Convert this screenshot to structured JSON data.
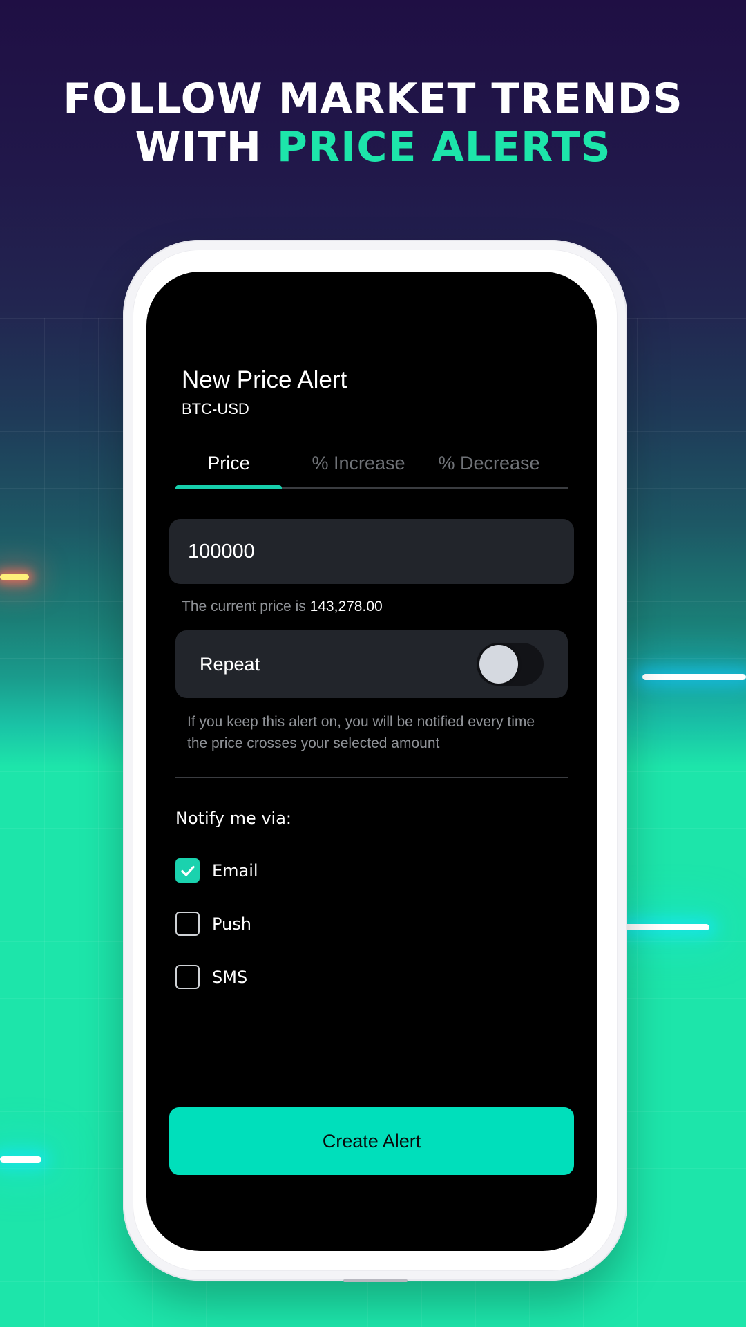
{
  "promo": {
    "headline_line1": "FOLLOW MARKET TRENDS",
    "headline_line2_prefix": "WITH ",
    "headline_line2_accent": "PRICE ALERTS"
  },
  "colors": {
    "accent": "#1de5aa",
    "button": "#00dfbb",
    "tab_indicator": "#17cfac",
    "checkbox_checked": "#1ad2ae",
    "background_top": "#1f0f44",
    "screen_bg": "#000000",
    "card_bg": "#22252b"
  },
  "screen": {
    "title": "New Price Alert",
    "pair": "BTC-USD",
    "tabs": [
      {
        "label": "Price",
        "active": true
      },
      {
        "label": "% Increase",
        "active": false
      },
      {
        "label": "% Decrease",
        "active": false
      }
    ],
    "price_input": {
      "value": "100000"
    },
    "current_price": {
      "prefix": "The current price is ",
      "value": "143,278.00"
    },
    "repeat": {
      "label": "Repeat",
      "enabled": false,
      "help": "If you keep this alert on, you will be notified every time the price crosses your selected amount"
    },
    "notify": {
      "label": "Notify me via:",
      "options": [
        {
          "label": "Email",
          "checked": true,
          "icon": "check-icon"
        },
        {
          "label": "Push",
          "checked": false
        },
        {
          "label": "SMS",
          "checked": false
        }
      ]
    },
    "create_button": {
      "label": "Create Alert"
    }
  }
}
